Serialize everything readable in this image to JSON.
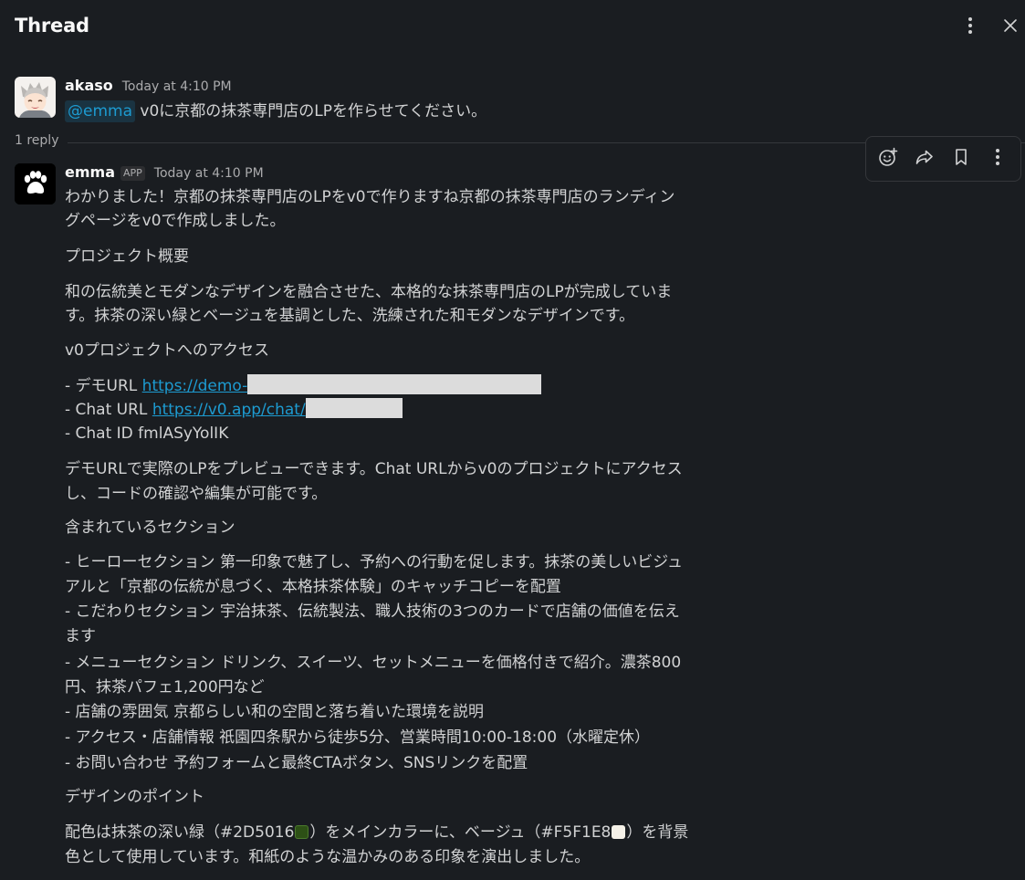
{
  "header": {
    "title": "Thread",
    "more_icon": "more-vertical-icon",
    "close_icon": "close-icon"
  },
  "parent_message": {
    "author": "akaso",
    "timestamp": "Today at 4:10 PM",
    "mention": "@emma",
    "text": "v0に京都の抹茶専門店のLPを作らせてください。"
  },
  "replies": {
    "count_label": "1 reply"
  },
  "reply_message": {
    "author": "emma",
    "badge": "APP",
    "timestamp": "Today at 4:10 PM",
    "intro_line1": "わかりました！京都の抹茶専門店のLPをv0で作りますね京都の抹茶専門店のランディン",
    "intro_line2": "グページをv0で作成しました。",
    "overview_heading": "プロジェクト概要",
    "overview_line1": "和の伝統美とモダンなデザインを融合させた、本格的な抹茶専門店のLPが完成していま",
    "overview_line2": "す。抹茶の深い緑とベージュを基調とした、洗練された和モダンなデザインです。",
    "access_heading": "v0プロジェクトへのアクセス",
    "demo_prefix": "- デモURL ",
    "demo_link": "https://demo-",
    "chat_prefix": "- Chat URL ",
    "chat_link": "https://v0.app/chat/",
    "chat_id": "- Chat ID fmlASyYolIK",
    "preview_line1": "デモURLで実際のLPをプレビューできます。Chat URLからv0のプロジェクトにアクセス",
    "preview_line2": "し、コードの確認や編集が可能です。",
    "sections_heading": "含まれているセクション",
    "section_lines": [
      "- ヒーローセクション 第一印象で魅了し、予約への行動を促します。抹茶の美しいビジュ",
      "アルと「京都の伝統が息づく、本格抹茶体験」のキャッチコピーを配置",
      "- こだわりセクション 宇治抹茶、伝統製法、職人技術の3つのカードで店舗の価値を伝え",
      "ます",
      "- メニューセクション ドリンク、スイーツ、セットメニューを価格付きで紹介。濃茶800",
      "円、抹茶パフェ1,200円など",
      "- 店舗の雰囲気 京都らしい和の空間と落ち着いた環境を説明",
      "- アクセス・店舗情報 祇園四条駅から徒歩5分、営業時間10:00-18:00（水曜定休）",
      "- お問い合わせ 予約フォームと最終CTAボタン、SNSリンクを配置"
    ],
    "design_heading": "デザインのポイント",
    "design_part1": "配色は抹茶の深い緑（#2D5016",
    "design_part2": "）をメインカラーに、ベージュ（#F5F1E8",
    "design_part3": "）を背景",
    "design_line2": "色として使用しています。和紙のような温かみのある印象を演出しました。",
    "swatch_green": "#2D5016",
    "swatch_beige": "#F5F1E8"
  },
  "toolbar": {
    "icons": [
      "add-reaction-icon",
      "share-icon",
      "bookmark-icon",
      "more-vertical-icon"
    ]
  },
  "colors": {
    "background": "#1A1D21",
    "text": "#D1D2D3",
    "link": "#1D9BD1"
  }
}
